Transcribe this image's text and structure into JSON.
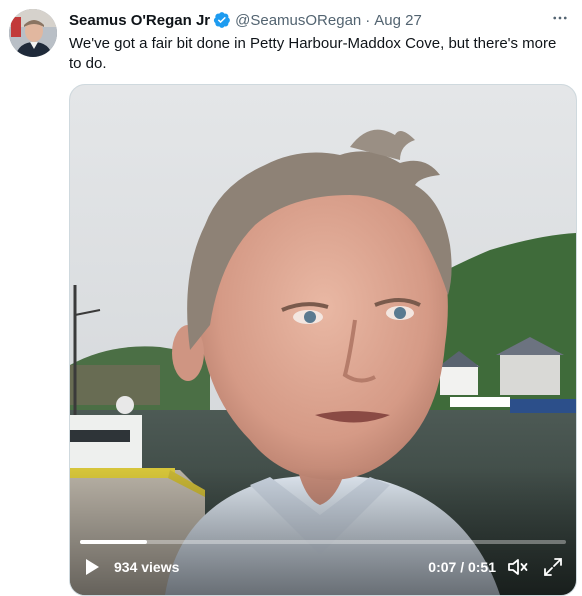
{
  "tweet": {
    "author_name": "Seamus O'Regan Jr",
    "handle": "@SeamusORegan",
    "separator": "·",
    "date": "Aug 27",
    "text": "We've got a fair bit done in Petty Harbour-Maddox Cove, but there's more to do.",
    "verified": true
  },
  "video": {
    "views": "934 views",
    "time": "0:07 / 0:51",
    "progress": 0.137
  },
  "colors": {
    "accent": "#1d9bf0",
    "secondary_text": "#536471"
  },
  "icons": {
    "more": "more-horizontal-icon",
    "play": "play-icon",
    "volume": "volume-icon",
    "fullscreen": "fullscreen-icon",
    "verified": "verified-badge-icon"
  }
}
